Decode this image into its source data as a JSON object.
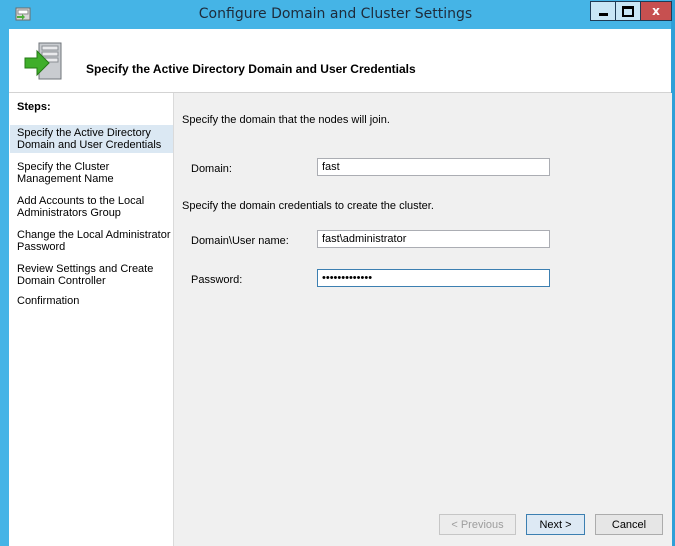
{
  "window": {
    "title": "Configure Domain and Cluster Settings",
    "close_glyph": "x",
    "icons": {
      "app": "server-wizard-icon",
      "header": "server-arrow-icon"
    }
  },
  "header": {
    "title": "Specify the Active Directory Domain and User Credentials"
  },
  "steps": {
    "label": "Steps:",
    "items": [
      {
        "label": "Specify the Active Directory Domain and User Credentials",
        "active": true
      },
      {
        "label": "Specify the Cluster Management Name",
        "active": false
      },
      {
        "label": "Add Accounts to the Local Administrators Group",
        "active": false
      },
      {
        "label": "Change the Local Administrator Password",
        "active": false
      },
      {
        "label": "Review Settings and Create Domain Controller",
        "active": false
      },
      {
        "label": "Confirmation",
        "active": false
      }
    ]
  },
  "form": {
    "domain_instruction": "Specify the domain that the nodes will join.",
    "domain_label": "Domain:",
    "domain_value": "fast",
    "credentials_instruction": "Specify the domain credentials to create the cluster.",
    "username_label": "Domain\\User name:",
    "username_value": "fast\\administrator",
    "password_label": "Password:",
    "password_value": "•••••••••••••"
  },
  "buttons": {
    "previous": "< Previous",
    "next": "Next >",
    "cancel": "Cancel"
  },
  "colors": {
    "title_bar": "#45b4e6",
    "close_button": "#c75050",
    "active_step": "#dbe8f3",
    "content_background": "#f0f0f0"
  }
}
